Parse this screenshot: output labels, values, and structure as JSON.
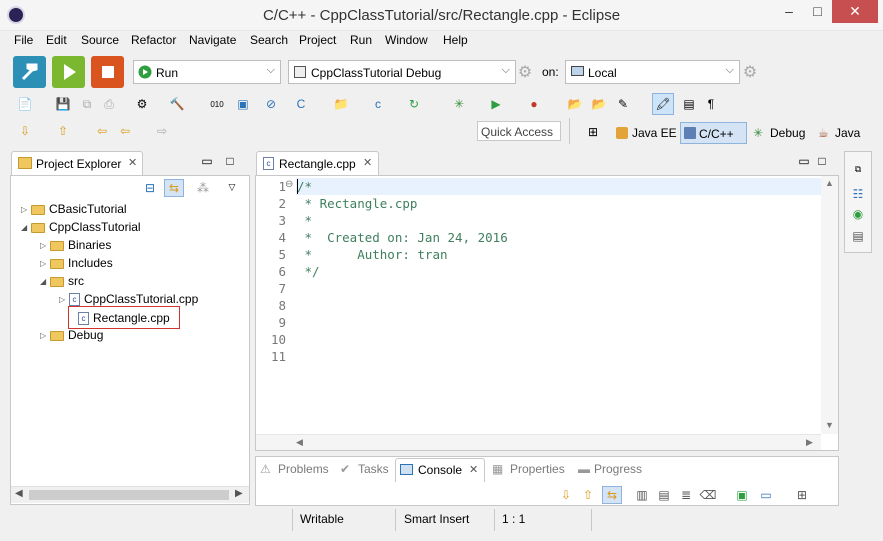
{
  "window": {
    "title": "C/C++ - CppClassTutorial/src/Rectangle.cpp - Eclipse",
    "minimize": "–",
    "maximize": "□",
    "close": "✕"
  },
  "menu": [
    "File",
    "Edit",
    "Source",
    "Refactor",
    "Navigate",
    "Search",
    "Project",
    "Run",
    "Window",
    "Help"
  ],
  "launch": {
    "mode": "Run",
    "config": "CppClassTutorial Debug",
    "on_label": "on:",
    "target": "Local"
  },
  "search": {
    "placeholder": "Quick Access"
  },
  "perspectives": [
    "Java EE",
    "C/C++",
    "Debug",
    "Java"
  ],
  "project_explorer": {
    "title": "Project Explorer",
    "tree": [
      {
        "label": "CBasicTutorial",
        "level": 0,
        "kind": "project",
        "expanded": false
      },
      {
        "label": "CppClassTutorial",
        "level": 0,
        "kind": "project",
        "expanded": true
      },
      {
        "label": "Binaries",
        "level": 1,
        "kind": "folder",
        "expanded": false
      },
      {
        "label": "Includes",
        "level": 1,
        "kind": "folder",
        "expanded": false
      },
      {
        "label": "src",
        "level": 1,
        "kind": "folder",
        "expanded": true
      },
      {
        "label": "CppClassTutorial.cpp",
        "level": 2,
        "kind": "cfile",
        "expanded": false
      },
      {
        "label": "Rectangle.cpp",
        "level": 2,
        "kind": "cfile",
        "selected": true
      },
      {
        "label": "Debug",
        "level": 1,
        "kind": "folder",
        "expanded": false
      }
    ]
  },
  "editor": {
    "tab": "Rectangle.cpp",
    "line_numbers": [
      "1",
      "2",
      "3",
      "4",
      "5",
      "6",
      "7",
      "8",
      "9",
      "10",
      "11"
    ],
    "lines": [
      "/*",
      " * Rectangle.cpp",
      " *",
      " *  Created on: Jan 24, 2016",
      " *      Author: tran",
      " */",
      "",
      "",
      "",
      "",
      ""
    ]
  },
  "bottom_tabs": [
    "Problems",
    "Tasks",
    "Console",
    "Properties",
    "Progress"
  ],
  "active_bottom_tab": "Console",
  "status": {
    "writable": "Writable",
    "insert_mode": "Smart Insert",
    "position": "1 : 1"
  },
  "colors": {
    "selection_box": "#d0342c",
    "comment": "#3f7f5f",
    "accent": "#2a73b8"
  }
}
